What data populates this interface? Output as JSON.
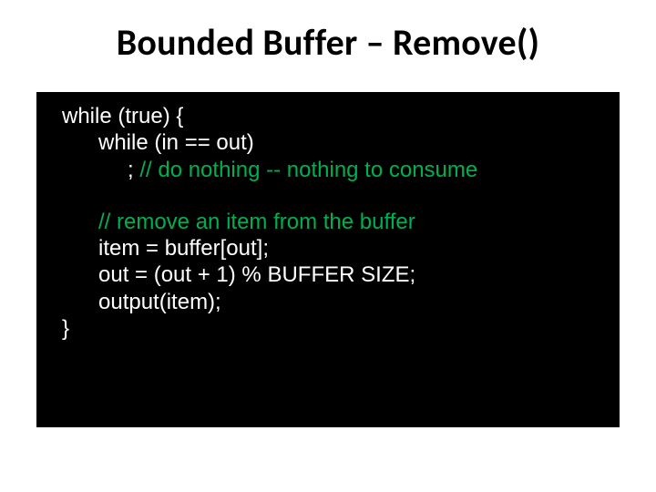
{
  "title": "Bounded Buffer – Remove()",
  "code": {
    "l1_a": "while (true) {",
    "l2_a": "while (in == out)",
    "l3_a": "; ",
    "l3_c": "// do nothing -- nothing to consume",
    "l4_c": "// remove an item from the buffer",
    "l5_a": "item = buffer[out];",
    "l6_a": "out = (out + 1) % BUFFER SIZE;",
    "l7_a": "output(item);",
    "l8_a": "}"
  }
}
